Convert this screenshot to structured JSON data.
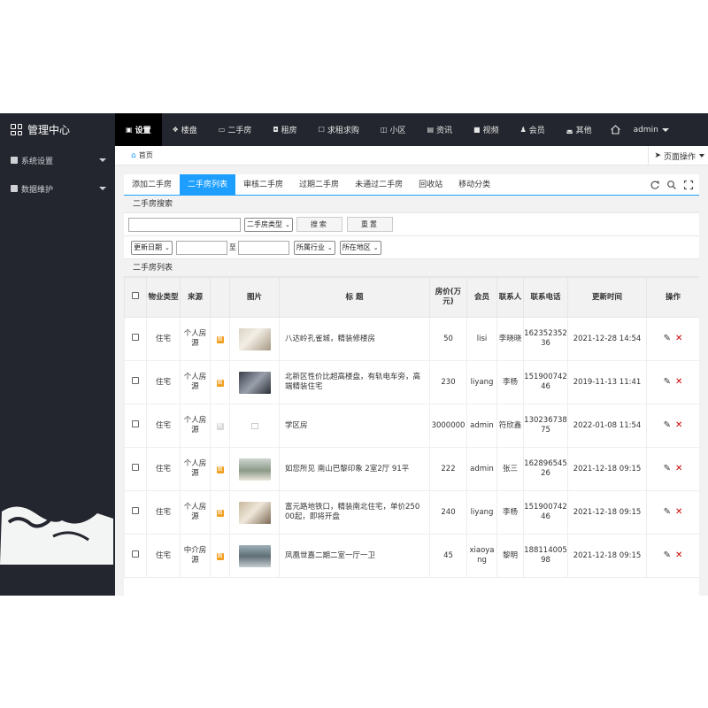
{
  "sidebar": {
    "brand": "管理中心",
    "items": [
      {
        "label": "系统设置",
        "icon": "settings-icon"
      },
      {
        "label": "数据维护",
        "icon": "database-icon"
      }
    ]
  },
  "topnav": {
    "items": [
      {
        "label": "设置",
        "icon": "▣",
        "active": true
      },
      {
        "label": "楼盘",
        "icon": "❖",
        "active": false
      },
      {
        "label": "二手房",
        "icon": "▭",
        "active": false
      },
      {
        "label": "租房",
        "icon": "◘",
        "active": false
      },
      {
        "label": "求租求购",
        "icon": "☐",
        "active": false
      },
      {
        "label": "小区",
        "icon": "◫",
        "active": false
      },
      {
        "label": "资讯",
        "icon": "▤",
        "active": false
      },
      {
        "label": "视频",
        "icon": "■",
        "active": false
      },
      {
        "label": "会员",
        "icon": "♟",
        "active": false
      },
      {
        "label": "其他",
        "icon": "◛",
        "active": false
      }
    ],
    "user": "admin"
  },
  "breadcrumb": {
    "home": "首页",
    "page_ops": "页面操作"
  },
  "tabs": [
    {
      "label": "添加二手房",
      "active": false
    },
    {
      "label": "二手房列表",
      "active": true
    },
    {
      "label": "审核二手房",
      "active": false
    },
    {
      "label": "过期二手房",
      "active": false
    },
    {
      "label": "未通过二手房",
      "active": false
    },
    {
      "label": "回收站",
      "active": false
    },
    {
      "label": "移动分类",
      "active": false
    }
  ],
  "search": {
    "title": "二手房搜索",
    "keyword_value": "",
    "type_select": "二手房类型",
    "search_button": "搜索",
    "reset_button": "重置",
    "date_select": "更新日期",
    "date_from": "",
    "date_to_label": "至",
    "date_to": "",
    "industry_select": "所属行业",
    "region_select": "所在地区"
  },
  "list": {
    "title": "二手房列表",
    "columns": [
      "",
      "物业类型",
      "来源",
      "",
      "图片",
      "标 题",
      "房价(万元)",
      "会员",
      "联系人",
      "联系电话",
      "更新时间",
      "操作"
    ],
    "rows": [
      {
        "type": "住宅",
        "source": "个人房源",
        "tag": "图",
        "tag_gray": false,
        "photo": "photo-1",
        "title": "八达岭孔雀城，精装修楼房",
        "price": "50",
        "member": "lisi",
        "contact": "李晓晓",
        "phone": "16235235236",
        "updated": "2021-12-28 14:54"
      },
      {
        "type": "住宅",
        "source": "个人房源",
        "tag": "图",
        "tag_gray": false,
        "photo": "photo-2",
        "title": "北新区性价比超高楼盘，有轨电车旁，高端精装住宅",
        "price": "230",
        "member": "liyang",
        "contact": "李杨",
        "phone": "15190074246",
        "updated": "2019-11-13 11:41"
      },
      {
        "type": "住宅",
        "source": "个人房源",
        "tag": "图",
        "tag_gray": true,
        "photo": "",
        "title": "学区房",
        "price": "3000000",
        "member": "admin",
        "contact": "符欣鑫",
        "phone": "13023673875",
        "updated": "2022-01-08 11:54"
      },
      {
        "type": "住宅",
        "source": "个人房源",
        "tag": "图",
        "tag_gray": false,
        "photo": "photo-4",
        "title": "如您所见 南山巴黎印象 2室2厅 91平",
        "price": "222",
        "member": "admin",
        "contact": "张三",
        "phone": "16289654526",
        "updated": "2021-12-18 09:15"
      },
      {
        "type": "住宅",
        "source": "个人房源",
        "tag": "图",
        "tag_gray": false,
        "photo": "photo-5",
        "title": "富元路地铁口，精装南北住宅，单价25000起，即将开盘",
        "price": "240",
        "member": "liyang",
        "contact": "李杨",
        "phone": "15190074246",
        "updated": "2021-12-18 09:15"
      },
      {
        "type": "住宅",
        "source": "中介房源",
        "tag": "图",
        "tag_gray": false,
        "photo": "photo-6",
        "title": "凤凰世嘉二期二室一厅一卫",
        "price": "45",
        "member": "xiaoyang",
        "contact": "黎明",
        "phone": "18811400598",
        "updated": "2021-12-18 09:15"
      }
    ]
  },
  "colors": {
    "sidebar_bg": "#23262e",
    "accent": "#1e9fff",
    "delete": "#cc0000",
    "tag": "#f0a020"
  }
}
